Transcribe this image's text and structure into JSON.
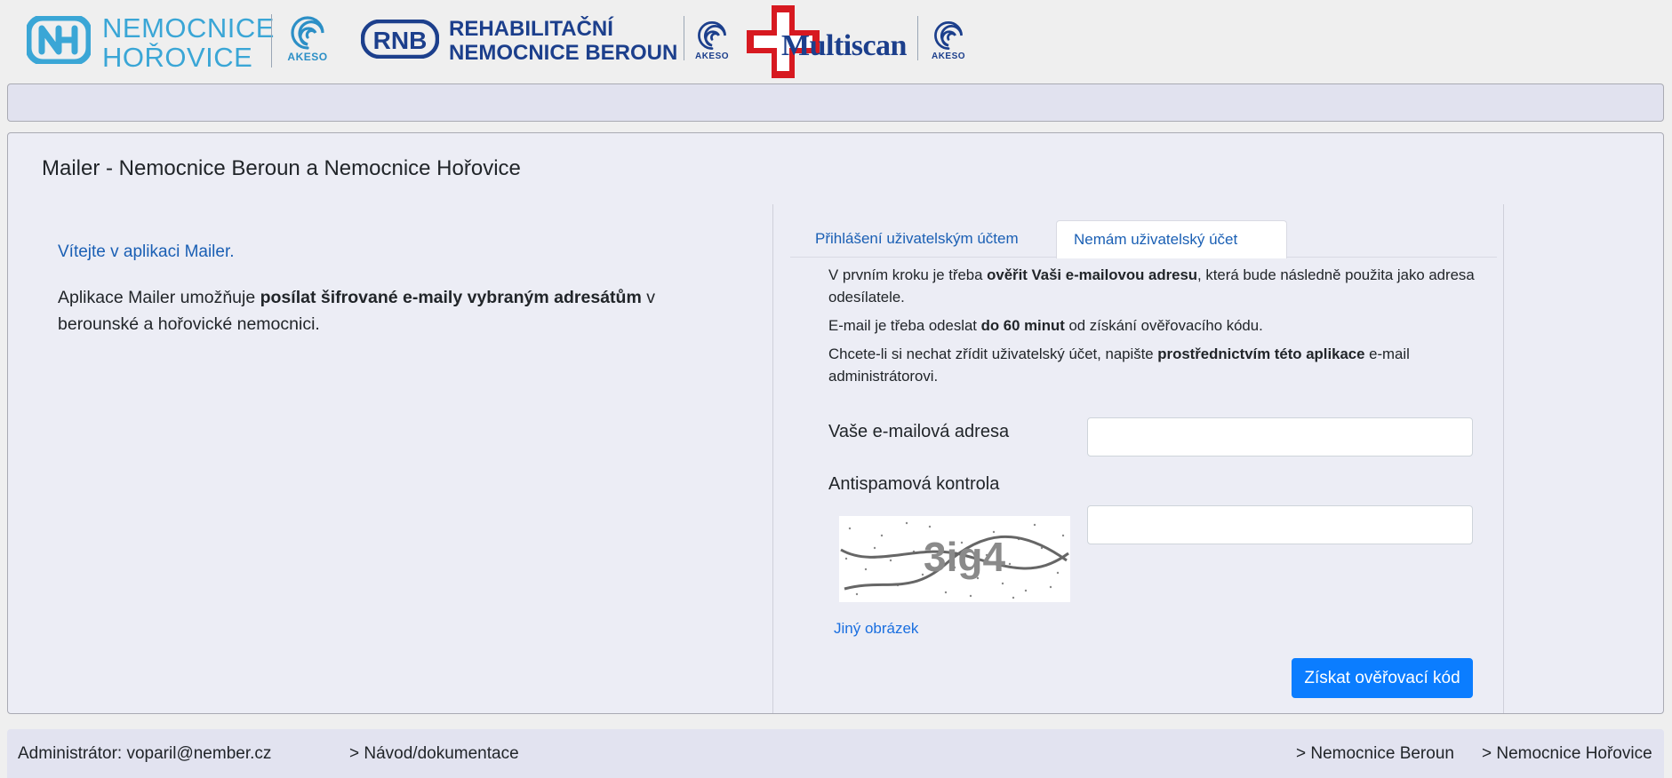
{
  "header": {
    "logo_nh": {
      "line1": "NEMOCNICE",
      "line2": "HOŘOVICE"
    },
    "logo_rnb": {
      "line1": "REHABILITAČNÍ",
      "line2": "NEMOCNICE BEROUN"
    },
    "logo_multiscan": "Multiscan",
    "akeso_label": "AKESO"
  },
  "main": {
    "title": "Mailer - Nemocnice Beroun a Nemocnice Hořovice",
    "welcome": "Vítejte v aplikaci Mailer.",
    "intro": {
      "part1": "Aplikace Mailer umožňuje ",
      "bold": "posílat šifrované e-maily vybraným adresátům",
      "part2": " v berounské a hořovické nemocnici."
    },
    "tabs": [
      {
        "label": "Přihlášení uživatelským účtem",
        "active": false
      },
      {
        "label": "Nemám uživatelský účet",
        "active": true
      }
    ],
    "info": [
      {
        "a": "V prvním kroku je třeba ",
        "b": "ověřit Vaši e-mailovou adresu",
        "c": ", která bude následně použita jako adresa odesílatele."
      },
      {
        "a": "E-mail je třeba odeslat ",
        "b": "do 60 minut",
        "c": " od získání ověřovacího kódu."
      },
      {
        "a": "Chcete-li si nechat zřídit uživatelský účet, napište ",
        "b": "prostřednictvím této aplikace",
        "c": " e-mail administrátorovi."
      }
    ],
    "form": {
      "email_label": "Vaše e-mailová adresa",
      "email_value": "",
      "captcha_label": "Antispamová kontrola",
      "captcha_value": "",
      "captcha_text": "3ig4",
      "other_image": "Jiný obrázek",
      "submit": "Získat ověřovací kód"
    }
  },
  "footer": {
    "admin": "Administrátor: voparil@nember.cz",
    "docs": "> Návod/dokumentace",
    "beroun": "> Nemocnice Beroun",
    "horovice": "> Nemocnice Hořovice"
  },
  "colors": {
    "accent": "#0b7dff",
    "link": "#1a5fb4",
    "card_bg": "#ecedf5",
    "page_bg": "#efefef"
  }
}
